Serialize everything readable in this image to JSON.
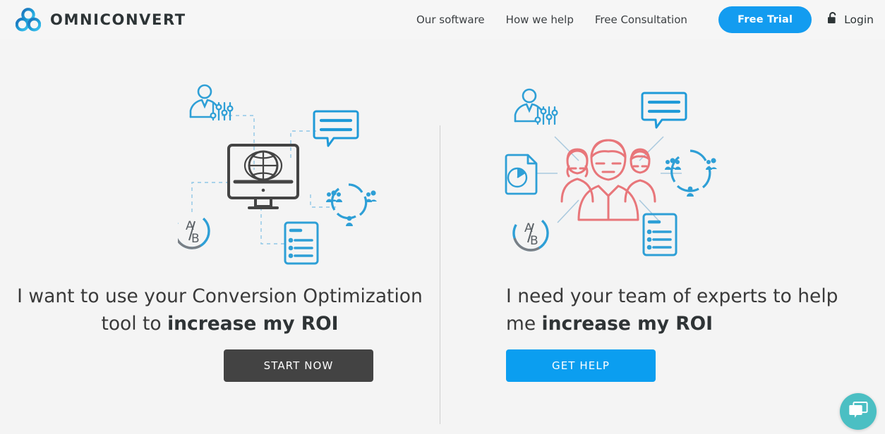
{
  "colors": {
    "page_bg": "#f4f4f4",
    "header_bg": "#f6f6f6",
    "accent_blue": "#139cf0",
    "dark_button": "#434343",
    "icon_blue": "#2e9fd6",
    "icon_blue_dark": "#1a7fb5",
    "icon_dark": "#444444",
    "team_pink": "#e8767a",
    "chat_teal": "#4bbfc3",
    "divider": "#cfcfcf",
    "text_dark": "#3a3a3a"
  },
  "header": {
    "brand": {
      "name": "OMNICONVERT",
      "logo_icon": "three-circles-logo-icon"
    },
    "nav": [
      {
        "label": "Our software"
      },
      {
        "label": "How we help"
      },
      {
        "label": "Free Consultation"
      }
    ],
    "free_trial_label": "Free Trial",
    "login": {
      "label": "Login",
      "icon": "open-padlock-icon"
    }
  },
  "main": {
    "left": {
      "illustration": {
        "name": "conversion-tool-illustration",
        "center_icon": "monitor-globe-icon",
        "satellites": [
          "person-sliders-icon",
          "speech-bubble-icon",
          "ab-test-icon",
          "donut-people-cycle-icon",
          "checklist-document-icon"
        ]
      },
      "headline_part1": "I want to use your Conversion Optimization tool to ",
      "headline_bold": "increase my ROI",
      "cta_label": "START NOW"
    },
    "right": {
      "illustration": {
        "name": "expert-team-illustration",
        "center_icon": "team-of-three-people-icon",
        "satellites": [
          "person-sliders-icon",
          "speech-bubble-icon",
          "pie-chart-document-icon",
          "donut-people-cycle-icon",
          "ab-test-icon",
          "checklist-document-icon"
        ]
      },
      "headline_part1": "I need your team of experts to help me ",
      "headline_bold": "increase my ROI",
      "cta_label": "GET HELP"
    }
  },
  "chat": {
    "icon": "chat-bubbles-icon",
    "tooltip": ""
  }
}
